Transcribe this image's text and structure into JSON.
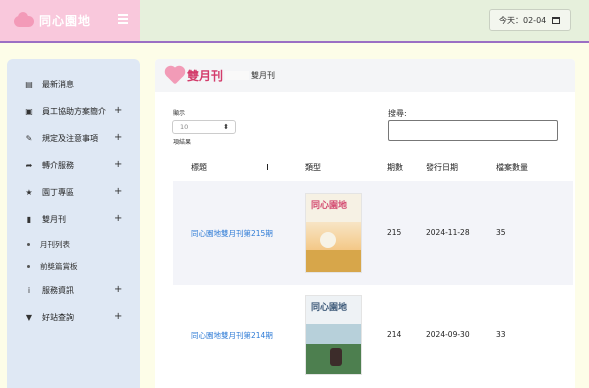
{
  "header": {
    "logo_text": "同心園地",
    "date_text": "今天：02-04"
  },
  "sidebar": {
    "items": [
      {
        "label": "最新消息",
        "icon": "newspaper-icon",
        "has_plus": false
      },
      {
        "label": "員工協助方案簡介",
        "icon": "document-icon",
        "has_plus": true
      },
      {
        "label": "規定及注意事項",
        "icon": "pencil-icon",
        "has_plus": true
      },
      {
        "label": "轉介服務",
        "icon": "share-icon",
        "has_plus": true
      },
      {
        "label": "園丁專區",
        "icon": "star-icon",
        "has_plus": true
      },
      {
        "label": "雙月刊",
        "icon": "bookmark-icon",
        "has_plus": true
      }
    ],
    "subitems": [
      "月刊列表",
      "前獎篇賞板"
    ],
    "items_after": [
      {
        "label": "服務資訊",
        "icon": "info-icon",
        "has_plus": true
      },
      {
        "label": "好站查詢",
        "icon": "filter-icon",
        "has_plus": true
      }
    ]
  },
  "main": {
    "title": "雙月刊",
    "breadcrumb": "雙月刊",
    "show_label": "顯示",
    "length_value": "10",
    "length_suffix": "項結果",
    "search_label": "搜尋:",
    "columns": [
      "標題",
      "類型",
      "期數",
      "發行日期",
      "檔案數量"
    ],
    "rows": [
      {
        "title": "同心園地雙月刊第215期",
        "issue": "215",
        "date": "2024-11-28",
        "files": "35",
        "cover_title": "同心園地"
      },
      {
        "title": "同心園地雙月刊第214期",
        "issue": "214",
        "date": "2024-09-30",
        "files": "33",
        "cover_title": "同心園地"
      }
    ]
  }
}
